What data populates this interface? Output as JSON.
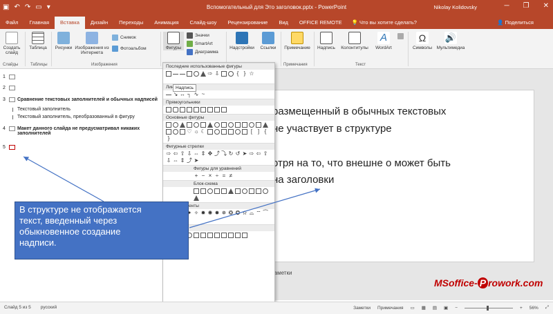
{
  "titlebar": {
    "title": "Вспомогательный для Это заголовок.pptx - PowerPoint",
    "user": "Nikolay Kolidovsky",
    "minimize": "─",
    "restore": "❐",
    "close": "✕",
    "accent": "#b7472a"
  },
  "tabs": {
    "items": [
      "Файл",
      "Главная",
      "Вставка",
      "Дизайн",
      "Переходы",
      "Анимация",
      "Слайд-шоу",
      "Рецензирование",
      "Вид",
      "OFFICE REMOTE"
    ],
    "active": "Вставка",
    "tell_me": "Что вы хотите сделать?",
    "share": "Поделиться"
  },
  "ribbon": {
    "new_slide": "Создать слайд",
    "table": "Таблица",
    "pictures": "Рисунки",
    "online_pictures": "Изображения из Интернета",
    "screenshot": "Снимок",
    "photo_album": "Фотоальбом",
    "shapes": "Фигуры",
    "icons": "Значки",
    "smartart": "SmartArt",
    "chart": "Диаграмма",
    "addins": "Надстройки",
    "links": "Ссылки",
    "comment": "Примечание",
    "textbox": "Надпись",
    "header_footer": "Колонтитулы",
    "wordart": "WordArt",
    "symbols": "Символы",
    "media": "Мультимедиа",
    "groups": {
      "slides": "Слайды",
      "tables": "Таблицы",
      "images": "Изображения",
      "comments": "Примечания",
      "text": "Текст"
    }
  },
  "outline": {
    "rows": [
      {
        "num": "1",
        "text": ""
      },
      {
        "num": "2",
        "text": ""
      },
      {
        "num": "3",
        "text": "Сравнение текстовых заполнителей и обычных надписей"
      },
      {
        "num": "4",
        "text": "Макет данного слайда не предусматривал никаких"
      },
      {
        "num": "5",
        "text": ""
      }
    ],
    "row4_line2": "заполнителей",
    "subs": [
      "Текстовый заполнитель",
      "Текстовый заполнитель, преобразованный в фигуру"
    ]
  },
  "dropdown": {
    "sections": [
      "Последние использованные фигуры",
      "Линии",
      "Прямоугольники",
      "Основные фигуры",
      "Фигурные стрелки",
      "Фигуры для уравнений",
      "Блок-схема",
      "Звезды и ленты",
      "Выноски"
    ],
    "tooltip": "Надпись"
  },
  "slide": {
    "lines": [
      "размещенный в обычных текстовых",
      "не участвует в структуре",
      "отря на то, что внешне о может быть",
      "на заголовки"
    ]
  },
  "notes": "заметки",
  "callout": {
    "lines": [
      "В структуре не отображается",
      "текст, введенный через",
      "обыкновенное создание",
      "надписи."
    ]
  },
  "logo": {
    "prefix": "MSoffice-",
    "highlight": "P",
    "suffix": "rowork.com"
  },
  "statusbar": {
    "slide": "Слайд 5 из 5",
    "lang": "русский",
    "notes": "Заметки",
    "comments": "Примечания",
    "zoom": "56%"
  }
}
